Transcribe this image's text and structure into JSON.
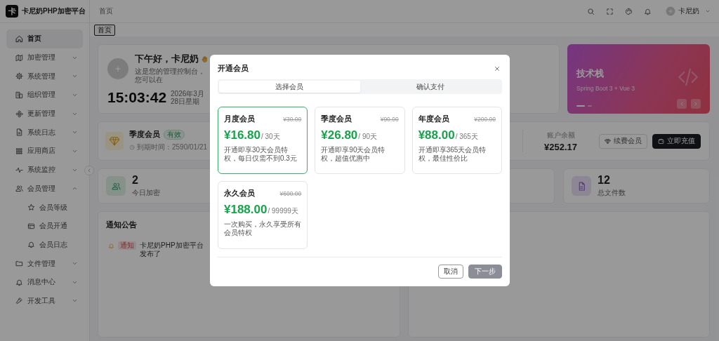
{
  "app": {
    "logo": "卡",
    "title": "卡尼奶PHP加密平台"
  },
  "header": {
    "breadcrumb": "首页",
    "user": "卡尼奶"
  },
  "tabs": [
    {
      "label": "首页",
      "selected": true
    }
  ],
  "sidebar": {
    "items": [
      {
        "label": "首页",
        "selected": true
      },
      {
        "label": "加密管理",
        "selected": false,
        "expanded": false
      },
      {
        "label": "系统管理",
        "selected": false,
        "expanded": false
      },
      {
        "label": "组织管理",
        "selected": false,
        "expanded": false
      },
      {
        "label": "更新管理",
        "selected": false,
        "expanded": false
      },
      {
        "label": "系统日志",
        "selected": false,
        "expanded": false
      },
      {
        "label": "应用商店",
        "selected": false,
        "expanded": false
      },
      {
        "label": "系统监控",
        "selected": false,
        "expanded": false
      },
      {
        "label": "会员管理",
        "selected": false,
        "expanded": true,
        "children": [
          {
            "label": "会员等级",
            "selected": false
          },
          {
            "label": "会员开通",
            "selected": false
          },
          {
            "label": "会员日志",
            "selected": false
          }
        ]
      },
      {
        "label": "文件管理",
        "selected": false,
        "expanded": false
      },
      {
        "label": "消息中心",
        "selected": false,
        "expanded": false
      },
      {
        "label": "开发工具",
        "selected": false,
        "expanded": false
      }
    ]
  },
  "welcome": {
    "greeting": "下午好，卡尼奶",
    "subtitle": "这是您的管理控制台，您可以在",
    "time": "15:03:42",
    "date": "2026年3月28日星期"
  },
  "banner": {
    "title": "技术栈",
    "subtitle": "Spring Boot 3 + Vue 3",
    "slides": [
      {
        "selected": true
      },
      {
        "selected": false
      }
    ]
  },
  "membership": {
    "plan": "季度会员",
    "badge": "有效",
    "expiry": "到期时间：2590/01/21",
    "balance_label": "账户余额",
    "balance": "¥252.17",
    "renew": "续费会员",
    "recharge": "立即充值"
  },
  "stats": [
    {
      "value": "2",
      "label": "今日加密"
    },
    {
      "value": "12",
      "label": "总文件数"
    }
  ],
  "notices": {
    "title": "通知公告",
    "items": [
      {
        "tag": "通知",
        "text": "卡尼奶PHP加密平台发布了"
      }
    ]
  },
  "modal": {
    "title": "开通会员",
    "steps": [
      {
        "label": "选择会员",
        "selected": true
      },
      {
        "label": "确认支付",
        "selected": false
      }
    ],
    "plans": [
      {
        "name": "月度会员",
        "original": "¥30.00",
        "price": "¥16.80",
        "period": "/ 30天",
        "description": "开通即享30天会员特权，每日仅需不到0.3元",
        "selected": true
      },
      {
        "name": "季度会员",
        "original": "¥90.00",
        "price": "¥26.80",
        "period": "/ 90天",
        "description": "开通即享90天会员特权，超值优惠中",
        "selected": false
      },
      {
        "name": "年度会员",
        "original": "¥200.00",
        "price": "¥88.00",
        "period": "/ 365天",
        "description": "开通即享365天会员特权，最佳性价比",
        "selected": false
      },
      {
        "name": "永久会员",
        "original": "¥600.00",
        "price": "¥188.00",
        "period": "/ 99999天",
        "description": "一次购买，永久享受所有会员特权",
        "selected": false
      }
    ],
    "buttons": [
      {
        "label": "取消",
        "kind": "secondary",
        "disabled": false
      },
      {
        "label": "下一步",
        "kind": "primary",
        "disabled": true
      }
    ]
  }
}
